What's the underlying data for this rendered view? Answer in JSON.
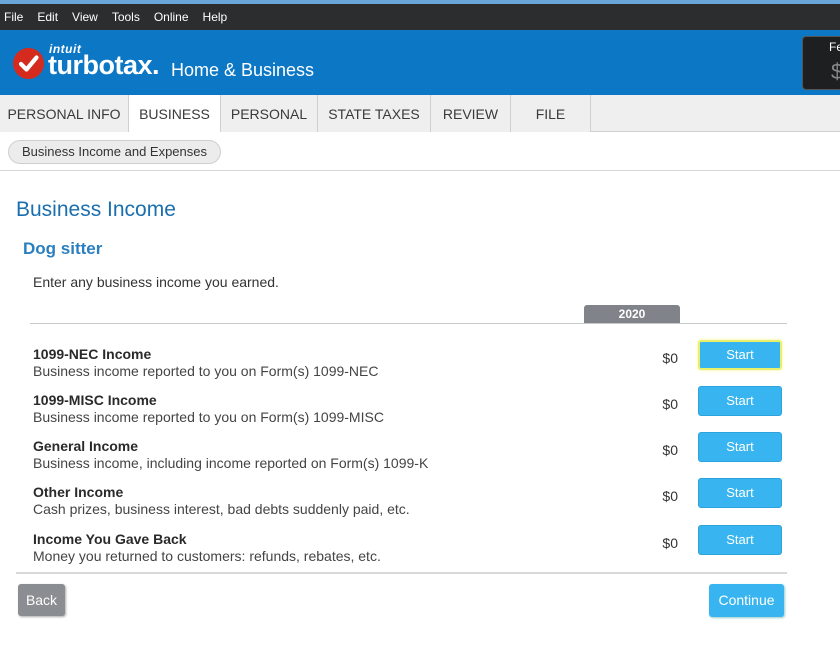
{
  "menubar": {
    "items": [
      "File",
      "Edit",
      "View",
      "Tools",
      "Online",
      "Help"
    ]
  },
  "brand": {
    "intuit": "intuit",
    "turbotax": "turbotax.",
    "product": "Home & Business",
    "refund_label": "Fe",
    "refund_amount": "$"
  },
  "tabs": [
    {
      "label": "PERSONAL INFO",
      "active": false
    },
    {
      "label": "BUSINESS",
      "active": true
    },
    {
      "label": "PERSONAL",
      "active": false
    },
    {
      "label": "STATE TAXES",
      "active": false
    },
    {
      "label": "REVIEW",
      "active": false
    },
    {
      "label": "FILE",
      "active": false
    }
  ],
  "breadcrumb": {
    "label": "Business Income and Expenses"
  },
  "page": {
    "title": "Business Income",
    "section": "Dog sitter",
    "intro": "Enter any business income you earned.",
    "year": "2020"
  },
  "rows": [
    {
      "title": "1099-NEC Income",
      "desc": "Business income reported to you on Form(s) 1099-NEC",
      "amount": "$0",
      "button": "Start"
    },
    {
      "title": "1099-MISC Income",
      "desc": "Business income reported to you on Form(s) 1099-MISC",
      "amount": "$0",
      "button": "Start"
    },
    {
      "title": "General Income",
      "desc": "Business income, including income reported on Form(s) 1099-K",
      "amount": "$0",
      "button": "Start"
    },
    {
      "title": "Other Income",
      "desc": "Cash prizes, business interest, bad debts suddenly paid, etc.",
      "amount": "$0",
      "button": "Start"
    },
    {
      "title": "Income You Gave Back",
      "desc": "Money you returned to customers: refunds, rebates, etc.",
      "amount": "$0",
      "button": "Start"
    }
  ],
  "footer": {
    "back_label": "Back",
    "continue_label": "Continue"
  },
  "colors": {
    "brand_blue": "#0b77c5",
    "title_blue": "#1b6fae",
    "button_blue": "#38b5f0",
    "logo_red": "#d52b1e",
    "menubar_bg": "#2b2d2f"
  }
}
